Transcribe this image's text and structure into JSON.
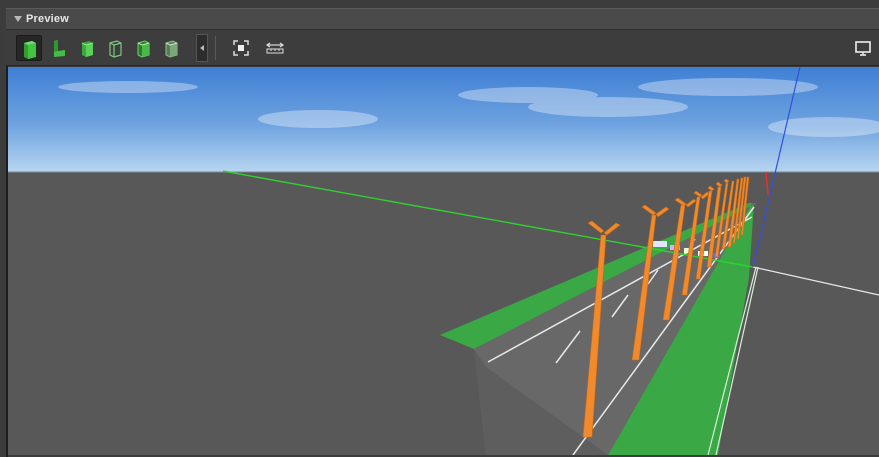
{
  "panel": {
    "title": "Preview"
  },
  "toolbar": {
    "buttons": [
      {
        "name": "solid-view-button",
        "icon": "solid-box-icon",
        "active": true
      },
      {
        "name": "section-view-button",
        "icon": "l-section-icon",
        "active": false
      },
      {
        "name": "box-view-button-1",
        "icon": "box-icon",
        "active": false
      },
      {
        "name": "box-view-button-2",
        "icon": "wire-box-icon",
        "active": false
      },
      {
        "name": "box-view-button-3",
        "icon": "box-outline-icon",
        "active": false
      },
      {
        "name": "box-view-button-4",
        "icon": "box-faded-icon",
        "active": false
      }
    ],
    "extra": [
      {
        "name": "zoom-extents-button",
        "icon": "zoom-extents-icon"
      },
      {
        "name": "measure-button",
        "icon": "ruler-icon"
      }
    ],
    "display_button": {
      "icon": "monitor-icon"
    }
  },
  "colors": {
    "accent_green": "#3fbf3f",
    "pole_orange": "#f08a2c",
    "ground": "#585858",
    "road": "#6a6a6a",
    "verge": "#3aa845",
    "axis_x": "#e03030",
    "axis_y": "#30d030",
    "axis_z": "#3050e0"
  }
}
